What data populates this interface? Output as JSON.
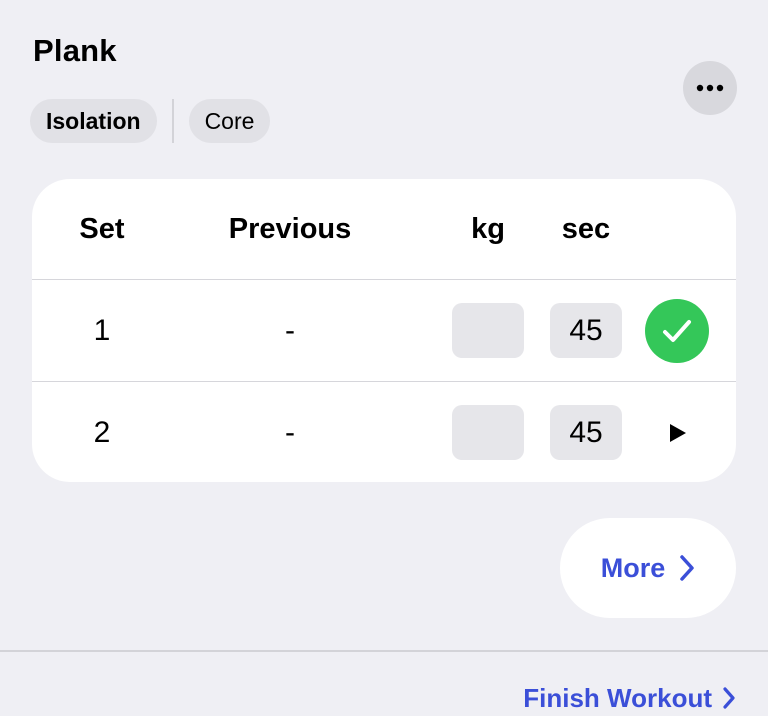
{
  "exercise": {
    "title": "Plank",
    "tags": [
      "Isolation",
      "Core"
    ]
  },
  "table": {
    "headers": {
      "set": "Set",
      "previous": "Previous",
      "kg": "kg",
      "sec": "sec"
    },
    "rows": [
      {
        "set": "1",
        "previous": "-",
        "kg": "",
        "sec": "45",
        "completed": true
      },
      {
        "set": "2",
        "previous": "-",
        "kg": "",
        "sec": "45",
        "completed": false
      }
    ]
  },
  "more_button": {
    "label": "More"
  },
  "finish_workout": {
    "label": "Finish Workout"
  },
  "colors": {
    "accent": "#3b4fd8",
    "success": "#34c759",
    "background": "#efeff4"
  },
  "icons": {
    "options": "ellipsis-icon",
    "done": "checkmark-icon",
    "start": "play-icon",
    "chevron": "chevron-right-icon"
  }
}
